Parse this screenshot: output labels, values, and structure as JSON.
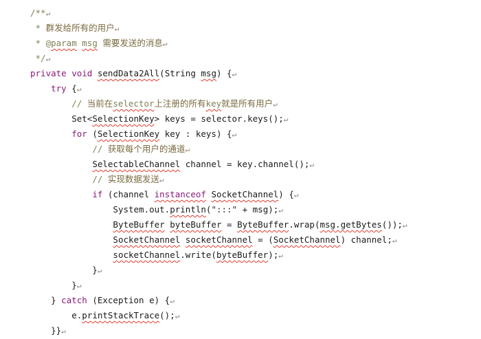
{
  "editor": {
    "language": "java",
    "lines": [
      {
        "tokens": [
          {
            "t": "/**",
            "c": "comment"
          },
          {
            "t": "↵",
            "c": "mark"
          }
        ]
      },
      {
        "tokens": [
          {
            "t": " * ",
            "c": "comment"
          },
          {
            "t": "群发给所有的用户",
            "c": "cjk"
          },
          {
            "t": "↵",
            "c": "mark"
          }
        ]
      },
      {
        "tokens": [
          {
            "t": " * @",
            "c": "comment"
          },
          {
            "t": "param",
            "c": "comment",
            "err": true
          },
          {
            "t": " ",
            "c": "comment"
          },
          {
            "t": "msg",
            "c": "comment",
            "err": true
          },
          {
            "t": " ",
            "c": "comment"
          },
          {
            "t": "需要发送的消息",
            "c": "cjk"
          },
          {
            "t": "↵",
            "c": "mark"
          }
        ]
      },
      {
        "tokens": [
          {
            "t": " */",
            "c": "comment"
          },
          {
            "t": "↵",
            "c": "mark"
          }
        ]
      },
      {
        "tokens": [
          {
            "t": "private",
            "c": "keyword"
          },
          {
            "t": " ",
            "c": "plain"
          },
          {
            "t": "void",
            "c": "keyword"
          },
          {
            "t": " ",
            "c": "plain"
          },
          {
            "t": "sendData2All",
            "c": "plain",
            "err": true
          },
          {
            "t": "(",
            "c": "plain"
          },
          {
            "t": "String",
            "c": "plain"
          },
          {
            "t": " ",
            "c": "plain"
          },
          {
            "t": "msg",
            "c": "plain",
            "err": true
          },
          {
            "t": ") {",
            "c": "plain"
          },
          {
            "t": "↵",
            "c": "mark"
          }
        ]
      },
      {
        "tokens": [
          {
            "t": "    ",
            "c": "plain"
          },
          {
            "t": "try",
            "c": "keyword"
          },
          {
            "t": " {",
            "c": "plain"
          },
          {
            "t": "↵",
            "c": "mark"
          }
        ]
      },
      {
        "tokens": [
          {
            "t": "        ",
            "c": "plain"
          },
          {
            "t": "// ",
            "c": "comment"
          },
          {
            "t": "当前在",
            "c": "cjk"
          },
          {
            "t": "selector",
            "c": "comment",
            "err": true
          },
          {
            "t": "上注册的所有",
            "c": "cjk"
          },
          {
            "t": "key",
            "c": "comment",
            "err": true
          },
          {
            "t": "就是所有用户",
            "c": "cjk"
          },
          {
            "t": "↵",
            "c": "mark"
          }
        ]
      },
      {
        "tokens": [
          {
            "t": "        ",
            "c": "plain"
          },
          {
            "t": "Set<",
            "c": "plain"
          },
          {
            "t": "SelectionKey",
            "c": "plain",
            "err": true
          },
          {
            "t": "> keys = selector.keys();",
            "c": "plain"
          },
          {
            "t": "↵",
            "c": "mark"
          }
        ]
      },
      {
        "tokens": [
          {
            "t": "        ",
            "c": "plain"
          },
          {
            "t": "for",
            "c": "keyword"
          },
          {
            "t": " (",
            "c": "plain"
          },
          {
            "t": "SelectionKey",
            "c": "plain",
            "err": true
          },
          {
            "t": " key : keys) {",
            "c": "plain"
          },
          {
            "t": "↵",
            "c": "mark"
          }
        ]
      },
      {
        "tokens": [
          {
            "t": "            ",
            "c": "plain"
          },
          {
            "t": "// ",
            "c": "comment"
          },
          {
            "t": "获取每个用户的通道",
            "c": "cjk"
          },
          {
            "t": "↵",
            "c": "mark"
          }
        ]
      },
      {
        "tokens": [
          {
            "t": "            ",
            "c": "plain"
          },
          {
            "t": "SelectableChannel",
            "c": "plain",
            "err": true
          },
          {
            "t": " channel = key.channel();",
            "c": "plain"
          },
          {
            "t": "↵",
            "c": "mark"
          }
        ]
      },
      {
        "tokens": [
          {
            "t": "            ",
            "c": "plain"
          },
          {
            "t": "// ",
            "c": "comment"
          },
          {
            "t": "实现数据发送",
            "c": "cjk"
          },
          {
            "t": "↵",
            "c": "mark"
          }
        ]
      },
      {
        "tokens": [
          {
            "t": "            ",
            "c": "plain"
          },
          {
            "t": "if",
            "c": "keyword"
          },
          {
            "t": " (channel ",
            "c": "plain"
          },
          {
            "t": "instanceof",
            "c": "keyword",
            "err": true
          },
          {
            "t": " ",
            "c": "plain"
          },
          {
            "t": "SocketChannel",
            "c": "plain",
            "err": true
          },
          {
            "t": ") {",
            "c": "plain"
          },
          {
            "t": "↵",
            "c": "mark"
          }
        ]
      },
      {
        "tokens": [
          {
            "t": "                ",
            "c": "plain"
          },
          {
            "t": "System.out.",
            "c": "plain"
          },
          {
            "t": "println",
            "c": "plain",
            "err": true
          },
          {
            "t": "(",
            "c": "plain"
          },
          {
            "t": "\":::\"",
            "c": "string"
          },
          {
            "t": " + msg);",
            "c": "plain"
          },
          {
            "t": "↵",
            "c": "mark"
          }
        ]
      },
      {
        "tokens": [
          {
            "t": "                ",
            "c": "plain"
          },
          {
            "t": "ByteBuffer",
            "c": "plain",
            "err": true
          },
          {
            "t": " ",
            "c": "plain"
          },
          {
            "t": "byteBuffer",
            "c": "plain",
            "err": true
          },
          {
            "t": " = ",
            "c": "plain"
          },
          {
            "t": "ByteBuffer",
            "c": "plain",
            "err": true
          },
          {
            "t": ".wrap(",
            "c": "plain"
          },
          {
            "t": "msg.getBytes",
            "c": "plain",
            "err": true
          },
          {
            "t": "());",
            "c": "plain"
          },
          {
            "t": "↵",
            "c": "mark"
          }
        ]
      },
      {
        "tokens": [
          {
            "t": "                ",
            "c": "plain"
          },
          {
            "t": "SocketChannel",
            "c": "plain",
            "err": true
          },
          {
            "t": " ",
            "c": "plain"
          },
          {
            "t": "socketChannel",
            "c": "plain",
            "err": true
          },
          {
            "t": " = (",
            "c": "plain"
          },
          {
            "t": "SocketChannel",
            "c": "plain",
            "err": true
          },
          {
            "t": ") channel;",
            "c": "plain"
          },
          {
            "t": "↵",
            "c": "mark"
          }
        ]
      },
      {
        "tokens": [
          {
            "t": "                ",
            "c": "plain"
          },
          {
            "t": "socketChannel",
            "c": "plain",
            "err": true
          },
          {
            "t": ".write(",
            "c": "plain"
          },
          {
            "t": "byteBuffer",
            "c": "plain",
            "err": true
          },
          {
            "t": ");",
            "c": "plain"
          },
          {
            "t": "↵",
            "c": "mark"
          }
        ]
      },
      {
        "tokens": [
          {
            "t": "            }",
            "c": "plain"
          },
          {
            "t": "↵",
            "c": "mark"
          }
        ]
      },
      {
        "tokens": [
          {
            "t": "        }",
            "c": "plain"
          },
          {
            "t": "↵",
            "c": "mark"
          }
        ]
      },
      {
        "tokens": [
          {
            "t": "    } ",
            "c": "plain"
          },
          {
            "t": "catch",
            "c": "keyword"
          },
          {
            "t": " (Exception e) {",
            "c": "plain"
          },
          {
            "t": "↵",
            "c": "mark"
          }
        ]
      },
      {
        "tokens": [
          {
            "t": "        e.",
            "c": "plain"
          },
          {
            "t": "printStackTrace",
            "c": "plain",
            "err": true
          },
          {
            "t": "();",
            "c": "plain"
          },
          {
            "t": "↵",
            "c": "mark"
          }
        ]
      },
      {
        "tokens": [
          {
            "t": "    }}",
            "c": "plain"
          },
          {
            "t": "↵",
            "c": "mark"
          }
        ]
      }
    ]
  }
}
